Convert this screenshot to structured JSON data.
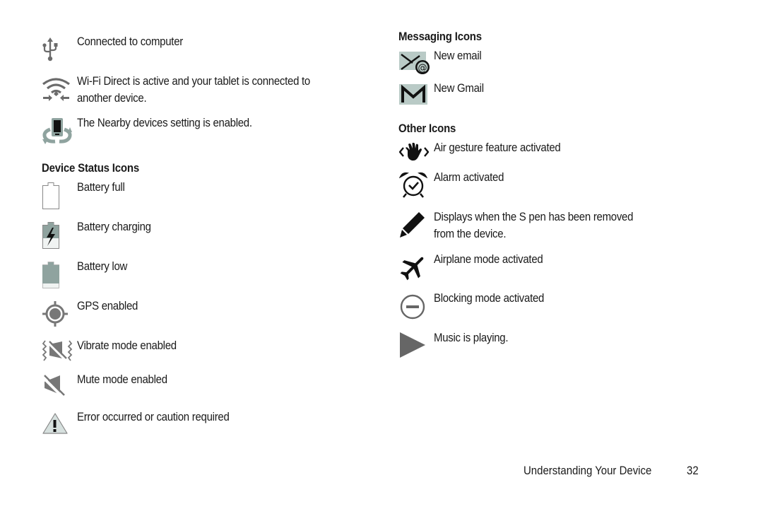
{
  "left_column": {
    "connectivity": [
      {
        "icon": "usb-icon",
        "text": "Connected to computer"
      },
      {
        "icon": "wifi-direct-icon",
        "text_line1": "Wi-Fi Direct is active and your tablet is connected to",
        "text_line2": "another device."
      },
      {
        "icon": "nearby-devices-icon",
        "text": "The Nearby devices setting is enabled."
      }
    ],
    "device_status": {
      "heading": "Device Status Icons",
      "items": [
        {
          "icon": "battery-full-icon",
          "text": "Battery full"
        },
        {
          "icon": "battery-charging-icon",
          "text": "Battery charging"
        },
        {
          "icon": "battery-low-icon",
          "text": "Battery low"
        },
        {
          "icon": "gps-icon",
          "text": "GPS enabled"
        },
        {
          "icon": "vibrate-icon",
          "text": "Vibrate mode enabled"
        },
        {
          "icon": "mute-icon",
          "text": "Mute mode enabled"
        },
        {
          "icon": "warning-icon",
          "text": "Error occurred or caution required"
        }
      ]
    }
  },
  "right_column": {
    "messaging": {
      "heading": "Messaging Icons",
      "items": [
        {
          "icon": "email-icon",
          "text": "New email"
        },
        {
          "icon": "gmail-icon",
          "text": "New Gmail"
        }
      ]
    },
    "other": {
      "heading": "Other Icons",
      "items": [
        {
          "icon": "air-gesture-icon",
          "text": "Air gesture feature activated"
        },
        {
          "icon": "alarm-icon",
          "text": "Alarm activated"
        },
        {
          "icon": "s-pen-icon",
          "text_line1": "Displays when the S pen has been removed",
          "text_line2": "from the device."
        },
        {
          "icon": "airplane-icon",
          "text": "Airplane mode activated"
        },
        {
          "icon": "blocking-mode-icon",
          "text": "Blocking mode activated"
        },
        {
          "icon": "music-playing-icon",
          "text": "Music is playing."
        }
      ]
    }
  },
  "footer": {
    "section": "Understanding Your Device",
    "page_number": "32"
  },
  "colors": {
    "icon_gray": "#6b6b6b",
    "icon_teal_gray": "#8fa39f",
    "icon_light": "#b9cac6",
    "text": "#1a1a1a"
  }
}
